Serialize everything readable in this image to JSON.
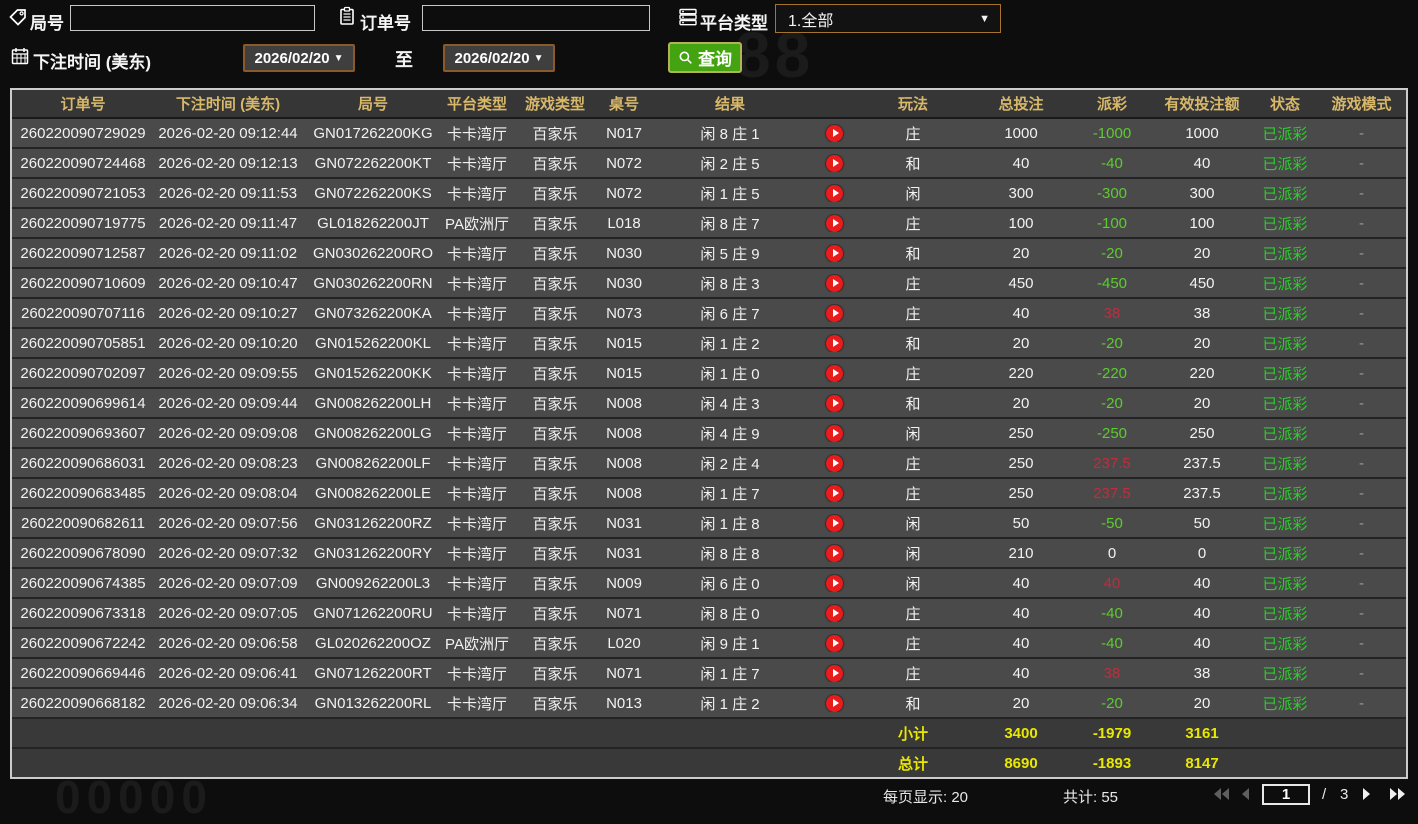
{
  "filters": {
    "game_no_label": "局号",
    "game_no_value": "",
    "order_no_label": "订单号",
    "order_no_value": "",
    "platform_label": "平台类型",
    "platform_value": "1.全部",
    "bet_time_label": "下注时间 (美东)",
    "date_from": "2026/02/20",
    "date_to": "2026/02/20",
    "to_label": "至",
    "search_label": "查询",
    "dropdown_arrow": "▼"
  },
  "icons": {
    "game_no": "tag-icon",
    "order_no": "clipboard-icon",
    "platform": "server-list-icon",
    "bet_time": "calendar-icon",
    "search": "search-icon",
    "row_action": "play-icon"
  },
  "colors": {
    "header_gold": "#d8b86a",
    "total_yellow": "#e8e800",
    "payout_negative_green": "#5ccc2e",
    "payout_positive_red": "#bf2d3e",
    "status_green": "#2ecc2e",
    "play_red": "#e81c1c",
    "search_green": "#44a310",
    "date_border_brown": "#8a5a28"
  },
  "table": {
    "headers": [
      "订单号",
      "下注时间 (美东)",
      "局号",
      "平台类型",
      "游戏类型",
      "桌号",
      "结果",
      "",
      "玩法",
      "总投注",
      "派彩",
      "有效投注额",
      "状态",
      "游戏模式"
    ],
    "rows": [
      {
        "order_no": "260220090729029",
        "bet_time": "2026-02-20 09:12:44",
        "game_no": "GN017262200KG",
        "platform": "卡卡湾厅",
        "game_type": "百家乐",
        "table_no": "N017",
        "result": "闲 8 庄 1",
        "bet_type": "庄",
        "total_bet": "1000",
        "payout": "-1000",
        "payout_class": "neg",
        "valid_bet": "1000",
        "status": "已派彩",
        "game_mode": "-"
      },
      {
        "order_no": "260220090724468",
        "bet_time": "2026-02-20 09:12:13",
        "game_no": "GN072262200KT",
        "platform": "卡卡湾厅",
        "game_type": "百家乐",
        "table_no": "N072",
        "result": "闲 2 庄 5",
        "bet_type": "和",
        "total_bet": "40",
        "payout": "-40",
        "payout_class": "neg",
        "valid_bet": "40",
        "status": "已派彩",
        "game_mode": "-"
      },
      {
        "order_no": "260220090721053",
        "bet_time": "2026-02-20 09:11:53",
        "game_no": "GN072262200KS",
        "platform": "卡卡湾厅",
        "game_type": "百家乐",
        "table_no": "N072",
        "result": "闲 1 庄 5",
        "bet_type": "闲",
        "total_bet": "300",
        "payout": "-300",
        "payout_class": "neg",
        "valid_bet": "300",
        "status": "已派彩",
        "game_mode": "-"
      },
      {
        "order_no": "260220090719775",
        "bet_time": "2026-02-20 09:11:47",
        "game_no": "GL018262200JT",
        "platform": "PA欧洲厅",
        "game_type": "百家乐",
        "table_no": "L018",
        "result": "闲 8 庄 7",
        "bet_type": "庄",
        "total_bet": "100",
        "payout": "-100",
        "payout_class": "neg",
        "valid_bet": "100",
        "status": "已派彩",
        "game_mode": "-"
      },
      {
        "order_no": "260220090712587",
        "bet_time": "2026-02-20 09:11:02",
        "game_no": "GN030262200RO",
        "platform": "卡卡湾厅",
        "game_type": "百家乐",
        "table_no": "N030",
        "result": "闲 5 庄 9",
        "bet_type": "和",
        "total_bet": "20",
        "payout": "-20",
        "payout_class": "neg",
        "valid_bet": "20",
        "status": "已派彩",
        "game_mode": "-"
      },
      {
        "order_no": "260220090710609",
        "bet_time": "2026-02-20 09:10:47",
        "game_no": "GN030262200RN",
        "platform": "卡卡湾厅",
        "game_type": "百家乐",
        "table_no": "N030",
        "result": "闲 8 庄 3",
        "bet_type": "庄",
        "total_bet": "450",
        "payout": "-450",
        "payout_class": "neg",
        "valid_bet": "450",
        "status": "已派彩",
        "game_mode": "-"
      },
      {
        "order_no": "260220090707116",
        "bet_time": "2026-02-20 09:10:27",
        "game_no": "GN073262200KA",
        "platform": "卡卡湾厅",
        "game_type": "百家乐",
        "table_no": "N073",
        "result": "闲 6 庄 7",
        "bet_type": "庄",
        "total_bet": "40",
        "payout": "38",
        "payout_class": "pos",
        "valid_bet": "38",
        "status": "已派彩",
        "game_mode": "-"
      },
      {
        "order_no": "260220090705851",
        "bet_time": "2026-02-20 09:10:20",
        "game_no": "GN015262200KL",
        "platform": "卡卡湾厅",
        "game_type": "百家乐",
        "table_no": "N015",
        "result": "闲 1 庄 2",
        "bet_type": "和",
        "total_bet": "20",
        "payout": "-20",
        "payout_class": "neg",
        "valid_bet": "20",
        "status": "已派彩",
        "game_mode": "-"
      },
      {
        "order_no": "260220090702097",
        "bet_time": "2026-02-20 09:09:55",
        "game_no": "GN015262200KK",
        "platform": "卡卡湾厅",
        "game_type": "百家乐",
        "table_no": "N015",
        "result": "闲 1 庄 0",
        "bet_type": "庄",
        "total_bet": "220",
        "payout": "-220",
        "payout_class": "neg",
        "valid_bet": "220",
        "status": "已派彩",
        "game_mode": "-"
      },
      {
        "order_no": "260220090699614",
        "bet_time": "2026-02-20 09:09:44",
        "game_no": "GN008262200LH",
        "platform": "卡卡湾厅",
        "game_type": "百家乐",
        "table_no": "N008",
        "result": "闲 4 庄 3",
        "bet_type": "和",
        "total_bet": "20",
        "payout": "-20",
        "payout_class": "neg",
        "valid_bet": "20",
        "status": "已派彩",
        "game_mode": "-"
      },
      {
        "order_no": "260220090693607",
        "bet_time": "2026-02-20 09:09:08",
        "game_no": "GN008262200LG",
        "platform": "卡卡湾厅",
        "game_type": "百家乐",
        "table_no": "N008",
        "result": "闲 4 庄 9",
        "bet_type": "闲",
        "total_bet": "250",
        "payout": "-250",
        "payout_class": "neg",
        "valid_bet": "250",
        "status": "已派彩",
        "game_mode": "-"
      },
      {
        "order_no": "260220090686031",
        "bet_time": "2026-02-20 09:08:23",
        "game_no": "GN008262200LF",
        "platform": "卡卡湾厅",
        "game_type": "百家乐",
        "table_no": "N008",
        "result": "闲 2 庄 4",
        "bet_type": "庄",
        "total_bet": "250",
        "payout": "237.5",
        "payout_class": "pos",
        "valid_bet": "237.5",
        "status": "已派彩",
        "game_mode": "-"
      },
      {
        "order_no": "260220090683485",
        "bet_time": "2026-02-20 09:08:04",
        "game_no": "GN008262200LE",
        "platform": "卡卡湾厅",
        "game_type": "百家乐",
        "table_no": "N008",
        "result": "闲 1 庄 7",
        "bet_type": "庄",
        "total_bet": "250",
        "payout": "237.5",
        "payout_class": "pos",
        "valid_bet": "237.5",
        "status": "已派彩",
        "game_mode": "-"
      },
      {
        "order_no": "260220090682611",
        "bet_time": "2026-02-20 09:07:56",
        "game_no": "GN031262200RZ",
        "platform": "卡卡湾厅",
        "game_type": "百家乐",
        "table_no": "N031",
        "result": "闲 1 庄 8",
        "bet_type": "闲",
        "total_bet": "50",
        "payout": "-50",
        "payout_class": "neg",
        "valid_bet": "50",
        "status": "已派彩",
        "game_mode": "-"
      },
      {
        "order_no": "260220090678090",
        "bet_time": "2026-02-20 09:07:32",
        "game_no": "GN031262200RY",
        "platform": "卡卡湾厅",
        "game_type": "百家乐",
        "table_no": "N031",
        "result": "闲 8 庄 8",
        "bet_type": "闲",
        "total_bet": "210",
        "payout": "0",
        "payout_class": "zero",
        "valid_bet": "0",
        "status": "已派彩",
        "game_mode": "-"
      },
      {
        "order_no": "260220090674385",
        "bet_time": "2026-02-20 09:07:09",
        "game_no": "GN009262200L3",
        "platform": "卡卡湾厅",
        "game_type": "百家乐",
        "table_no": "N009",
        "result": "闲 6 庄 0",
        "bet_type": "闲",
        "total_bet": "40",
        "payout": "40",
        "payout_class": "pos",
        "valid_bet": "40",
        "status": "已派彩",
        "game_mode": "-"
      },
      {
        "order_no": "260220090673318",
        "bet_time": "2026-02-20 09:07:05",
        "game_no": "GN071262200RU",
        "platform": "卡卡湾厅",
        "game_type": "百家乐",
        "table_no": "N071",
        "result": "闲 8 庄 0",
        "bet_type": "庄",
        "total_bet": "40",
        "payout": "-40",
        "payout_class": "neg",
        "valid_bet": "40",
        "status": "已派彩",
        "game_mode": "-"
      },
      {
        "order_no": "260220090672242",
        "bet_time": "2026-02-20 09:06:58",
        "game_no": "GL020262200OZ",
        "platform": "PA欧洲厅",
        "game_type": "百家乐",
        "table_no": "L020",
        "result": "闲 9 庄 1",
        "bet_type": "庄",
        "total_bet": "40",
        "payout": "-40",
        "payout_class": "neg",
        "valid_bet": "40",
        "status": "已派彩",
        "game_mode": "-"
      },
      {
        "order_no": "260220090669446",
        "bet_time": "2026-02-20 09:06:41",
        "game_no": "GN071262200RT",
        "platform": "卡卡湾厅",
        "game_type": "百家乐",
        "table_no": "N071",
        "result": "闲 1 庄 7",
        "bet_type": "庄",
        "total_bet": "40",
        "payout": "38",
        "payout_class": "pos",
        "valid_bet": "38",
        "status": "已派彩",
        "game_mode": "-"
      },
      {
        "order_no": "260220090668182",
        "bet_time": "2026-02-20 09:06:34",
        "game_no": "GN013262200RL",
        "platform": "卡卡湾厅",
        "game_type": "百家乐",
        "table_no": "N013",
        "result": "闲 1 庄 2",
        "bet_type": "和",
        "total_bet": "20",
        "payout": "-20",
        "payout_class": "neg",
        "valid_bet": "20",
        "status": "已派彩",
        "game_mode": "-"
      }
    ],
    "subtotal": {
      "label": "小计",
      "total_bet": "3400",
      "payout": "-1979",
      "valid_bet": "3161"
    },
    "grand_total": {
      "label": "总计",
      "total_bet": "8690",
      "payout": "-1893",
      "valid_bet": "8147"
    }
  },
  "footer": {
    "per_page_label": "每页显示:",
    "per_page_value": "20",
    "total_label": "共计:",
    "total_value": "55",
    "current_page": "1",
    "page_separator": "/",
    "total_pages": "3"
  }
}
